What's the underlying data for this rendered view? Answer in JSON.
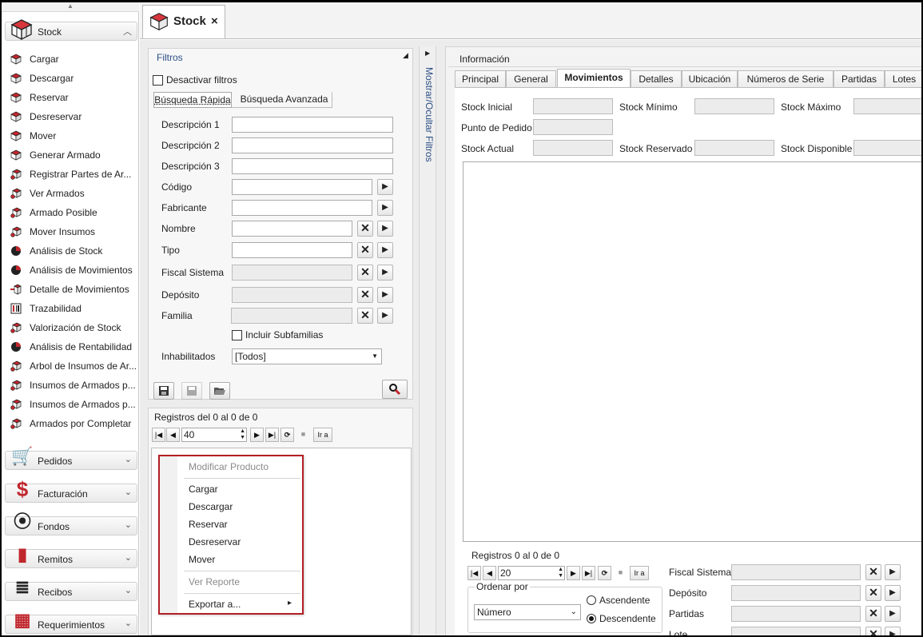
{
  "nav": {
    "stock_group": {
      "label": "Stock",
      "icon": "stock-box-icon"
    },
    "items": [
      {
        "label": "Cargar"
      },
      {
        "label": "Descargar"
      },
      {
        "label": "Reservar"
      },
      {
        "label": "Desreservar"
      },
      {
        "label": "Mover"
      },
      {
        "label": "Generar Armado"
      },
      {
        "label": "Registrar Partes de Ar..."
      },
      {
        "label": "Ver Armados"
      },
      {
        "label": "Armado Posible"
      },
      {
        "label": "Mover Insumos"
      },
      {
        "label": "Análisis de Stock"
      },
      {
        "label": "Análisis de Movimientos"
      },
      {
        "label": "Detalle de Movimientos"
      },
      {
        "label": "Trazabilidad"
      },
      {
        "label": "Valorización de Stock"
      },
      {
        "label": "Análisis de Rentabilidad"
      },
      {
        "label": "Arbol de Insumos de Ar..."
      },
      {
        "label": "Insumos de Armados p..."
      },
      {
        "label": "Insumos de Armados p..."
      },
      {
        "label": "Armados por Completar"
      }
    ],
    "groups": [
      {
        "label": "Pedidos",
        "icon": "cart-icon"
      },
      {
        "label": "Facturación",
        "icon": "dollar-icon"
      },
      {
        "label": "Fondos",
        "icon": "money-icon"
      },
      {
        "label": "Remitos",
        "icon": "handtruck-icon"
      },
      {
        "label": "Recibos",
        "icon": "receipt-icon"
      },
      {
        "label": "Requerimientos",
        "icon": "basket-icon"
      }
    ]
  },
  "doc_tab": {
    "title": "Stock",
    "close": "×"
  },
  "filters": {
    "title": "Filtros",
    "disable_label": "Desactivar filtros",
    "tabs": [
      "Búsqueda Rápida",
      "Búsqueda Avanzada"
    ],
    "fields": {
      "descripcion1": "Descripción 1",
      "descripcion2": "Descripción 2",
      "descripcion3": "Descripción 3",
      "codigo": "Código",
      "fabricante": "Fabricante",
      "nombre": "Nombre",
      "tipo": "Tipo",
      "fiscal": "Fiscal Sistema",
      "deposito": "Depósito",
      "familia": "Familia"
    },
    "subfamilias": "Incluir Subfamilias",
    "inhabilitados_label": "Inhabilitados",
    "inhabilitados_value": "[Todos]"
  },
  "vertical_label": "Mostrar/Ocultar Filtros",
  "results": {
    "registros": "Registros del 0 al 0 de 0",
    "page_size": "40",
    "go": "Ir a"
  },
  "context_menu": {
    "modificar": "Modificar Producto",
    "cargar": "Cargar",
    "descargar": "Descargar",
    "reservar": "Reservar",
    "desreservar": "Desreservar",
    "mover": "Mover",
    "ver_reporte": "Ver Reporte",
    "exportar": "Exportar a...",
    "arrow": "▸"
  },
  "info": {
    "title": "Información",
    "tabs": [
      "Principal",
      "General",
      "Movimientos",
      "Detalles",
      "Ubicación",
      "Números de Serie",
      "Partidas",
      "Lotes"
    ],
    "stock_inicial": "Stock Inicial",
    "stock_minimo": "Stock Mínimo",
    "stock_maximo": "Stock Máximo",
    "punto_pedido": "Punto de Pedido",
    "stock_actual": "Stock Actual",
    "stock_reservado": "Stock Reservado",
    "stock_disponible": "Stock Disponible",
    "registros": "Registros 0 al 0 de 0",
    "page_size": "20",
    "go": "Ir a",
    "ordenar_por": "Ordenar por",
    "ordenar_value": "Número",
    "ascendente": "Ascendente",
    "descendente": "Descendente",
    "fiscal_sistema": "Fiscal Sistema",
    "deposito": "Depósito",
    "partidas": "Partidas",
    "lote": "Lote"
  },
  "colors": {
    "accent_red": "#b21f24",
    "icon_red": "#c0272d"
  }
}
